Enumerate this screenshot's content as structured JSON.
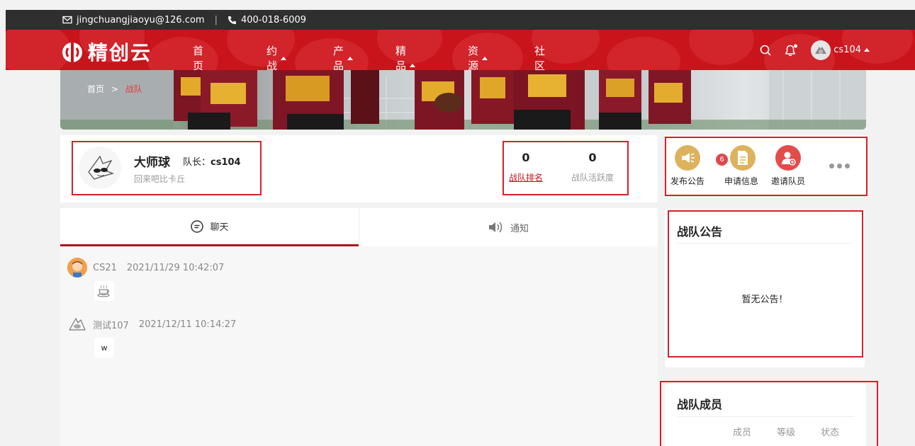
{
  "topbar": {
    "email": "jingchuangjiaoyu@126.com",
    "separator": "|",
    "phone": "400-018-6009"
  },
  "nav": {
    "logo_text": "精创云",
    "items": [
      {
        "label": "首页",
        "has_caret": false
      },
      {
        "label": "约战",
        "has_caret": true
      },
      {
        "label": "产品",
        "has_caret": true
      },
      {
        "label": "精品课",
        "has_caret": true
      },
      {
        "label": "资源",
        "has_caret": true
      },
      {
        "label": "社区",
        "has_caret": false
      }
    ],
    "username": "cs104",
    "icons": [
      "search-icon",
      "bell-icon",
      "avatar",
      "caret-up-icon"
    ]
  },
  "breadcrumb": {
    "home": "首页",
    "sep": ">",
    "current": "战队"
  },
  "team": {
    "name": "大师球",
    "captain_label": "队长：",
    "captain_name": "cs104",
    "slogan": "回来吧比卡丘",
    "rank_value": "0",
    "rank_label": "战队排名",
    "activity_value": "0",
    "activity_label": "战队活跃度"
  },
  "actions": {
    "publish_label": "发布公告",
    "apply_label": "申请信息",
    "apply_badge": "6",
    "invite_label": "邀请队员",
    "colors": {
      "gold": "#ddb25c",
      "red": "#e44b4b"
    }
  },
  "chat": {
    "tabs": [
      {
        "label": "聊天",
        "icon": "chat-icon",
        "active": true
      },
      {
        "label": "通知",
        "icon": "speaker-icon",
        "active": false
      }
    ],
    "messages": [
      {
        "user": "CS21",
        "time": "2021/11/29 10:42:07",
        "content_icon": "coffee-emoji"
      },
      {
        "user": "测试107",
        "time": "2021/12/11 10:14:27",
        "content": "w"
      }
    ]
  },
  "notice": {
    "title": "战队公告",
    "empty_text": "暂无公告！"
  },
  "members": {
    "title": "战队成员",
    "columns": [
      "成员",
      "等级",
      "状态"
    ]
  },
  "colors": {
    "brand_red": "#c9141c",
    "topbar_dark": "#2f2f2f",
    "annotation_red": "#d62027"
  }
}
